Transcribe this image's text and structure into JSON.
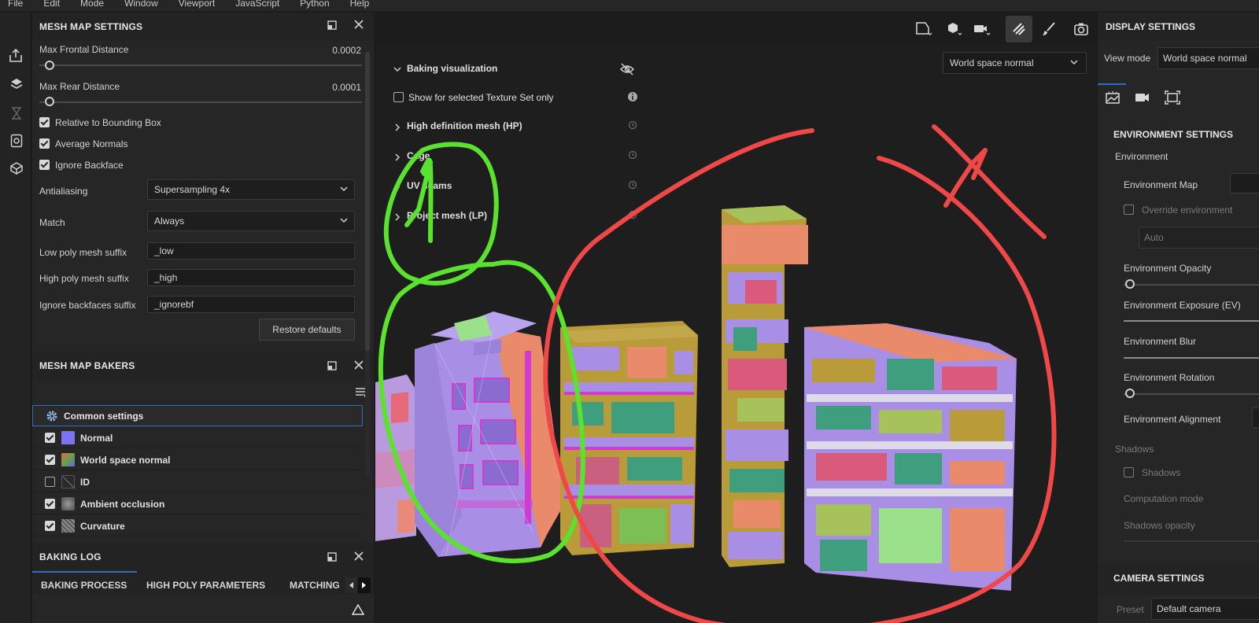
{
  "menubar": [
    "File",
    "Edit",
    "Mode",
    "Window",
    "Viewport",
    "JavaScript",
    "Python",
    "Help"
  ],
  "mesh_map_settings": {
    "title": "MESH MAP SETTINGS",
    "max_frontal_distance_label": "Max Frontal Distance",
    "max_frontal_distance_value": "0.0002",
    "max_rear_distance_label": "Max Rear Distance",
    "max_rear_distance_value": "0.0001",
    "relative_to_bbox": "Relative to Bounding Box",
    "average_normals": "Average Normals",
    "ignore_backface": "Ignore Backface",
    "antialiasing_label": "Antialiasing",
    "antialiasing_value": "Supersampling 4x",
    "match_label": "Match",
    "match_value": "Always",
    "low_poly_suffix_label": "Low poly mesh suffix",
    "low_poly_suffix_value": "_low",
    "high_poly_suffix_label": "High poly mesh suffix",
    "high_poly_suffix_value": "_high",
    "ignore_backfaces_suffix_label": "Ignore backfaces suffix",
    "ignore_backfaces_suffix_value": "_ignorebf",
    "restore_defaults": "Restore defaults"
  },
  "mesh_map_bakers": {
    "title": "MESH MAP BAKERS",
    "common_settings": "Common settings",
    "items": [
      {
        "label": "Normal",
        "checked": true,
        "color": "#7b73f0"
      },
      {
        "label": "World space normal",
        "checked": true,
        "color": "#c97a4a"
      },
      {
        "label": "ID",
        "checked": false,
        "color": "#2a2a2a"
      },
      {
        "label": "Ambient occlusion",
        "checked": true,
        "color": "#6f6f6f"
      },
      {
        "label": "Curvature",
        "checked": true,
        "color": "#8a8a8a"
      }
    ]
  },
  "baking_log": {
    "title": "BAKING LOG",
    "tabs": [
      "BAKING PROCESS",
      "HIGH POLY PARAMETERS",
      "MATCHING"
    ]
  },
  "viewport": {
    "view_select": "World space normal",
    "baking_visualization": "Baking visualization",
    "show_selected": "Show for selected Texture Set only",
    "high_definition_mesh": "High definition mesh (HP)",
    "cage": "Cage",
    "uv_seams": "UV seams",
    "project_mesh": "Project mesh (LP)",
    "annotation_number": "1"
  },
  "display_settings": {
    "title": "DISPLAY SETTINGS",
    "view_mode_label": "View mode",
    "view_mode_value": "World space normal",
    "environment_settings": "ENVIRONMENT SETTINGS",
    "environment": "Environment",
    "environment_map": "Environment Map",
    "override_environment": "Override environment",
    "auto": "Auto",
    "environment_opacity": "Environment Opacity",
    "environment_exposure": "Environment Exposure (EV)",
    "environment_blur": "Environment Blur",
    "environment_rotation": "Environment Rotation",
    "environment_alignment": "Environment Alignment",
    "shadows_section": "Shadows",
    "shadows_checkbox": "Shadows",
    "computation_mode": "Computation mode",
    "shadows_opacity": "Shadows opacity",
    "camera_settings": "CAMERA SETTINGS",
    "preset_label": "Preset",
    "preset_value": "Default camera"
  },
  "colors": {
    "accent": "#2d6fc0",
    "annotation_green": "#5be22e",
    "annotation_red": "#f04848"
  }
}
